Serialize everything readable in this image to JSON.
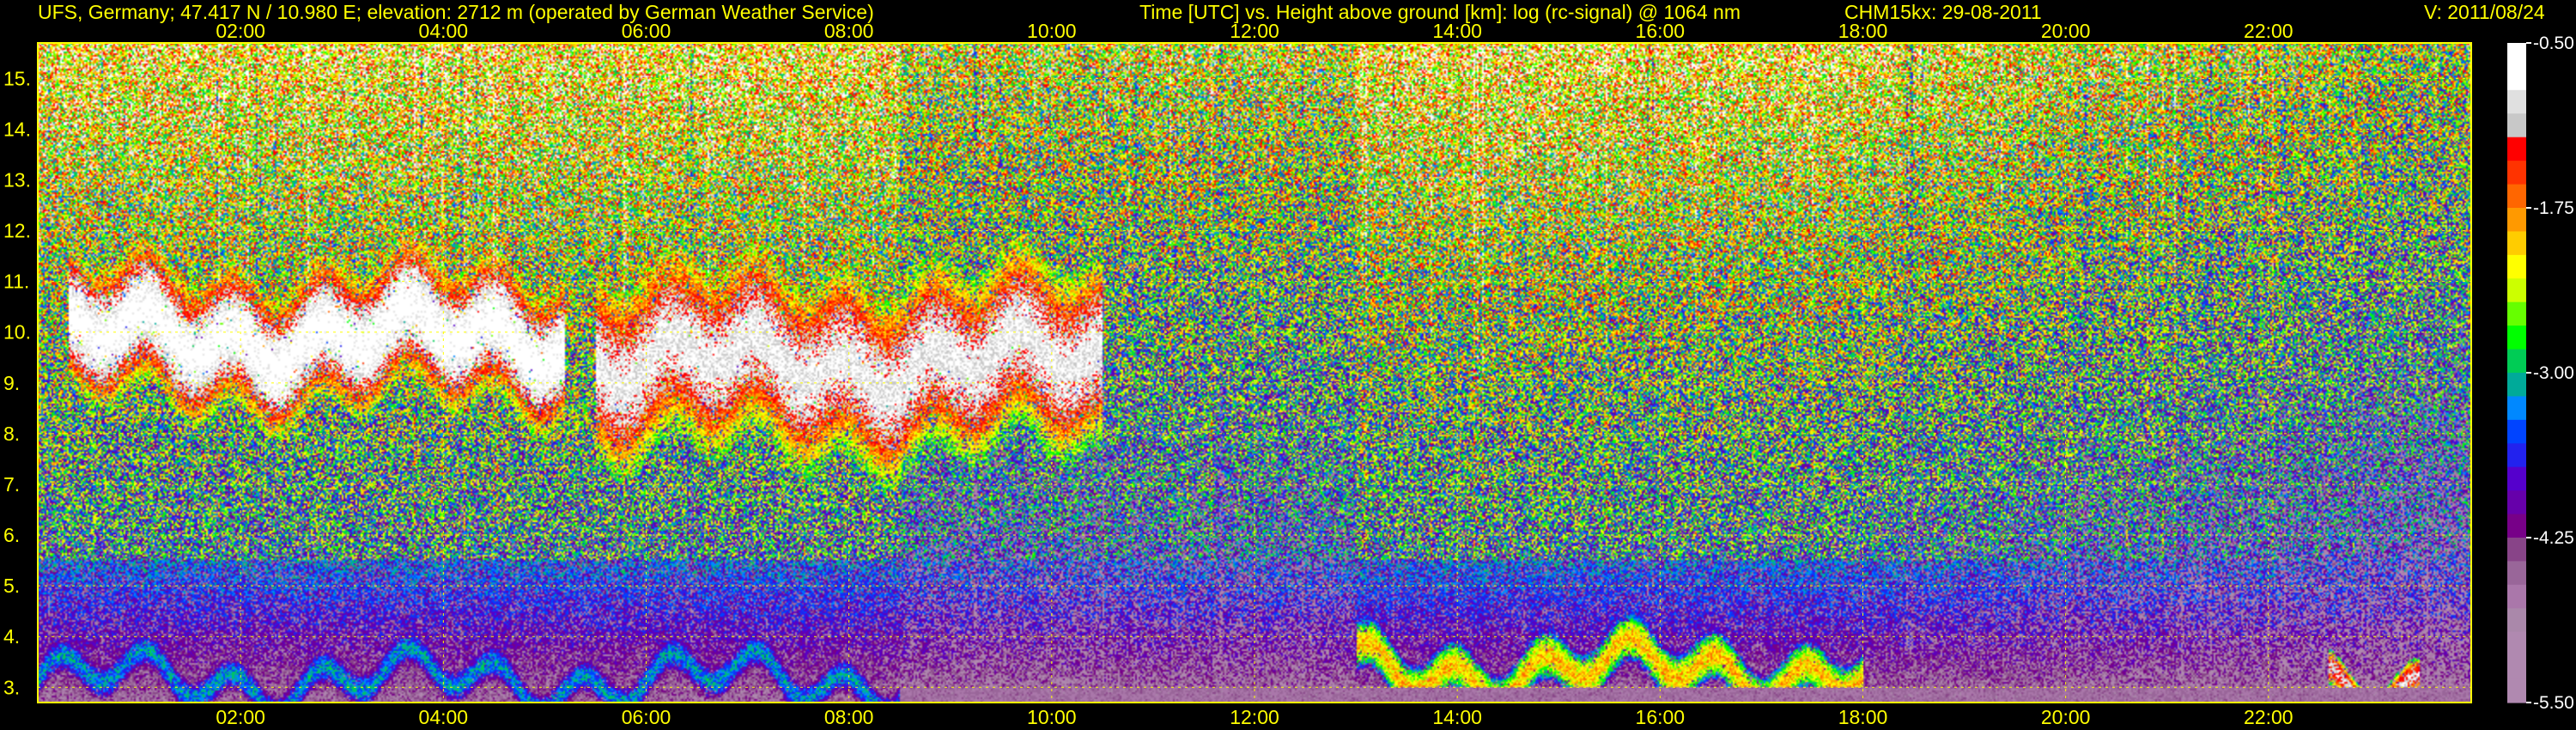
{
  "header": {
    "site": "UFS, Germany; 47.417 N / 10.980 E; elevation: 2712 m  (operated by German Weather Service)",
    "description": "Time [UTC] vs. Height above ground [km]: log (rc-signal) @ 1064 nm",
    "instrument": "CHM15kx: 29-08-2011",
    "version": "V: 2011/08/24"
  },
  "chart_data": {
    "type": "heatmap",
    "title": "Time [UTC] vs. Height above ground [km]: log (rc-signal) @ 1064 nm",
    "x": {
      "unit": "hours UTC",
      "range": [
        0,
        24
      ],
      "ticks": [
        2,
        4,
        6,
        8,
        10,
        12,
        14,
        16,
        18,
        20,
        22
      ],
      "tick_labels": [
        "02:00",
        "04:00",
        "06:00",
        "08:00",
        "10:00",
        "12:00",
        "14:00",
        "16:00",
        "18:00",
        "20:00",
        "22:00"
      ]
    },
    "y": {
      "unit": "km",
      "range": [
        2.7,
        15.7
      ],
      "ticks": [
        3,
        4,
        5,
        6,
        7,
        8,
        9,
        10,
        11,
        12,
        13,
        14,
        15
      ],
      "tick_labels": [
        "3.",
        "4.",
        "5.",
        "6.",
        "7.",
        "8.",
        "9.",
        "10.",
        "11.",
        "12.",
        "13.",
        "14.",
        "15."
      ]
    },
    "grid": true,
    "colorbar": {
      "range": [
        -5.5,
        -0.5
      ],
      "ticks": [
        -0.5,
        -1.75,
        -3.0,
        -4.25,
        -5.5
      ],
      "tick_labels": [
        "-0.50",
        "-1.75",
        "-3.00",
        "-4.25",
        "-5.50"
      ],
      "colors": [
        "#ffffff",
        "#ffffff",
        "#e0e0e0",
        "#c8c8c8",
        "#ff0000",
        "#ff3300",
        "#ff6600",
        "#ff9900",
        "#ffcc00",
        "#ffff00",
        "#ccff00",
        "#66ff00",
        "#00ff00",
        "#00cc55",
        "#00aa99",
        "#0088ff",
        "#0044ff",
        "#2222ee",
        "#5500cc",
        "#6600aa",
        "#770088",
        "#884488",
        "#996699",
        "#aa77aa",
        "#aa88aa",
        "#b089b0",
        "#b089b0",
        "#b089b0"
      ]
    },
    "features": [
      {
        "kind": "cirrus",
        "t": [
          0.3,
          5.2
        ],
        "z": [
          8.5,
          11.3
        ],
        "level": -0.5
      },
      {
        "kind": "cirrus",
        "t": [
          5.5,
          10.5
        ],
        "z": [
          7.5,
          11.3
        ],
        "level": -0.8
      },
      {
        "kind": "boundary_layer",
        "t": [
          0.0,
          8.5
        ],
        "z": [
          2.7,
          3.6
        ],
        "level": -3.2
      },
      {
        "kind": "low_cloud",
        "t": [
          13.0,
          18.0
        ],
        "z": [
          2.8,
          3.9
        ],
        "level": -2.0
      },
      {
        "kind": "low_cloud",
        "t": [
          22.6,
          23.5
        ],
        "z": [
          2.8,
          3.5
        ],
        "level": -1.0
      }
    ]
  }
}
